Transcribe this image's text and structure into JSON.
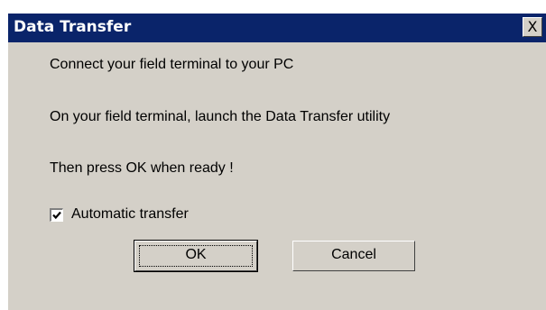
{
  "window": {
    "title": "Data Transfer",
    "close_label": "X"
  },
  "messages": {
    "line1": "Connect your field terminal to your PC",
    "line2": "On your field terminal, launch the Data Transfer utility",
    "line3": "Then press OK when ready !"
  },
  "checkbox": {
    "label": "Automatic transfer",
    "checked": true
  },
  "buttons": {
    "ok_label": "OK",
    "cancel_label": "Cancel"
  },
  "icons": {
    "close": "close-icon",
    "check": "checkmark-icon"
  }
}
